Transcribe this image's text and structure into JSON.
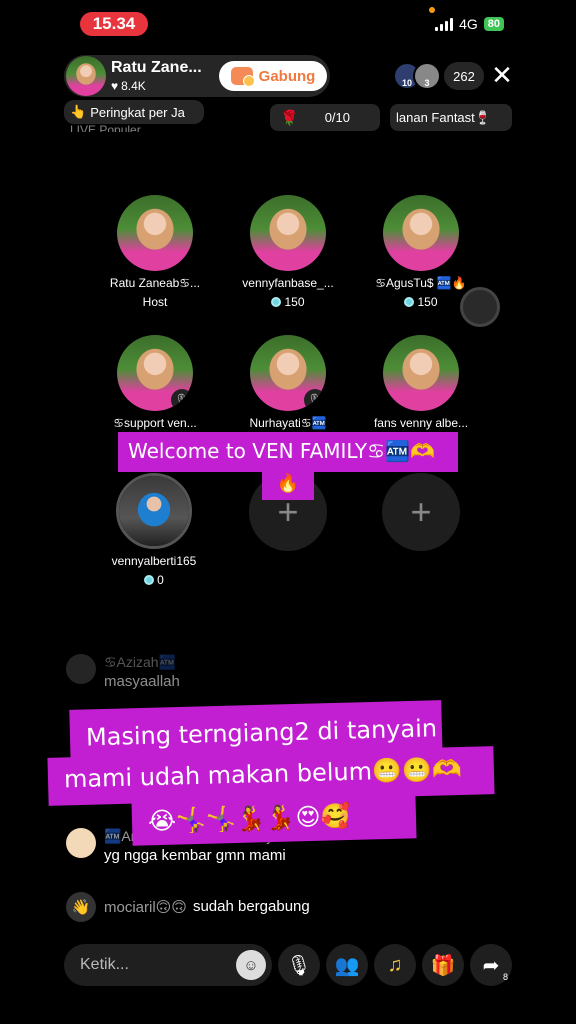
{
  "status_bar": {
    "time": "15.34",
    "network": "4G",
    "battery": "80"
  },
  "host": {
    "name": "Ratu Zane...",
    "likes": "8.4K",
    "join_label": "Gabung"
  },
  "viewers": {
    "badge_1": "10",
    "badge_2": "3",
    "count": "262"
  },
  "close_icon": "✕",
  "chips": {
    "ranking": "Peringkat per Ja",
    "ranking_sub": "LIVE Populer",
    "goal": "0/10",
    "fantasy": "lanan Fantast"
  },
  "seats": [
    {
      "name": "Ratu Zaneab♋...",
      "sub": "Host"
    },
    {
      "name": "vennyfanbase_...",
      "coins": "150"
    },
    {
      "name": "♋AgusTu$ 🏧🔥",
      "coins": "150"
    },
    {
      "name": "♋support ven...",
      "muted": true
    },
    {
      "name": "Nurhayati♋🏧",
      "muted": true
    },
    {
      "name": "fans venny albe..."
    },
    {
      "name": "vennyalberti165",
      "coins": "0"
    }
  ],
  "captions": {
    "welcome_line1": "Welcome to VEN FAMILY♋🏧🫶",
    "welcome_line2": "🔥",
    "main_line1": "Masing terngiang2 di tanyain",
    "main_line2": "mami udah makan belum😬😬🫶",
    "main_line3": "😭🤸‍♀️🤸‍♀️💃💃😍🥰"
  },
  "chat": [
    {
      "name": "♋Azizah🏧",
      "text": "masyaallah"
    },
    {
      "name": "🏧Anita Usman,fans venny♋",
      "text": "yg ngga kembar gmn mami"
    },
    {
      "name": "mociaril🙃🙃",
      "text": "sudah bergabung"
    }
  ],
  "bottom": {
    "input_placeholder": "Ketik...",
    "share_count": "8"
  },
  "colors": {
    "accent_caption": "#c21fd2",
    "time_pill": "#e8343d",
    "join_text": "#f07a3e",
    "battery": "#3fc556"
  }
}
